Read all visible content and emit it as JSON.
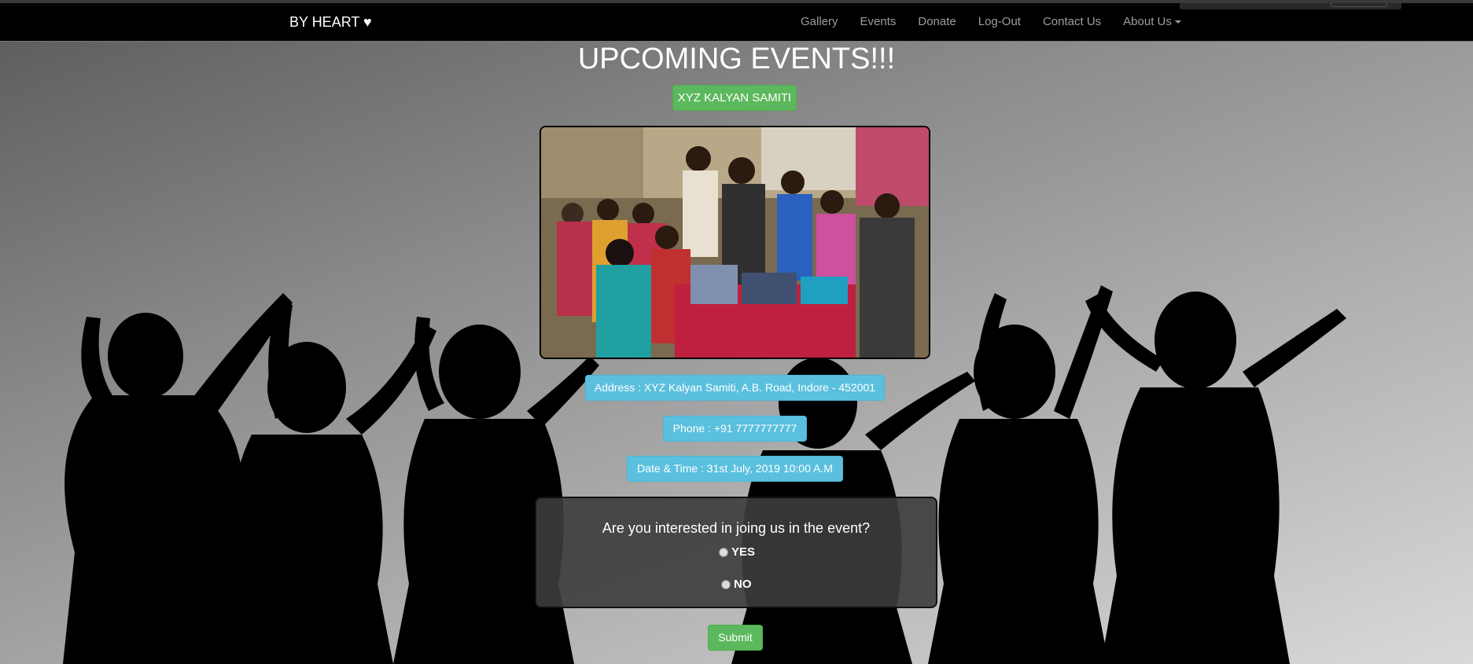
{
  "navbar": {
    "brand": "BY HEART ♥",
    "links": [
      "Gallery",
      "Events",
      "Donate",
      "Log-Out",
      "Contact Us",
      "About Us"
    ]
  },
  "page": {
    "title": "UPCOMING EVENTS!!!"
  },
  "event": {
    "org_name": "XYZ KALYAN SAMITI",
    "address": "Address : XYZ Kalyan Samiti, A.B. Road, Indore - 452001",
    "phone": "Phone : +91 7777777777",
    "datetime": "Date & Time : 31st July, 2019 10:00 A.M"
  },
  "form": {
    "question": "Are you interested in joing us in the event?",
    "options": [
      "YES",
      "NO"
    ],
    "submit_label": "Submit"
  },
  "colors": {
    "navbar_bg": "#000000",
    "success": "#5cb85c",
    "info": "#5bc0de"
  }
}
